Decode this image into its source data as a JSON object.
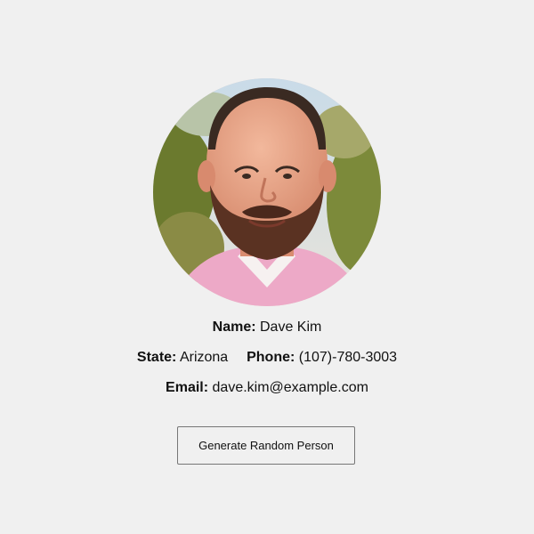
{
  "person": {
    "name_label": "Name:",
    "name": "Dave Kim",
    "state_label": "State:",
    "state": "Arizona",
    "phone_label": "Phone:",
    "phone": "(107)-780-3003",
    "email_label": "Email:",
    "email": "dave.kim@example.com"
  },
  "actions": {
    "generate_label": "Generate Random Person"
  },
  "colors": {
    "background": "#f0f0f0",
    "button_border": "#767676"
  }
}
